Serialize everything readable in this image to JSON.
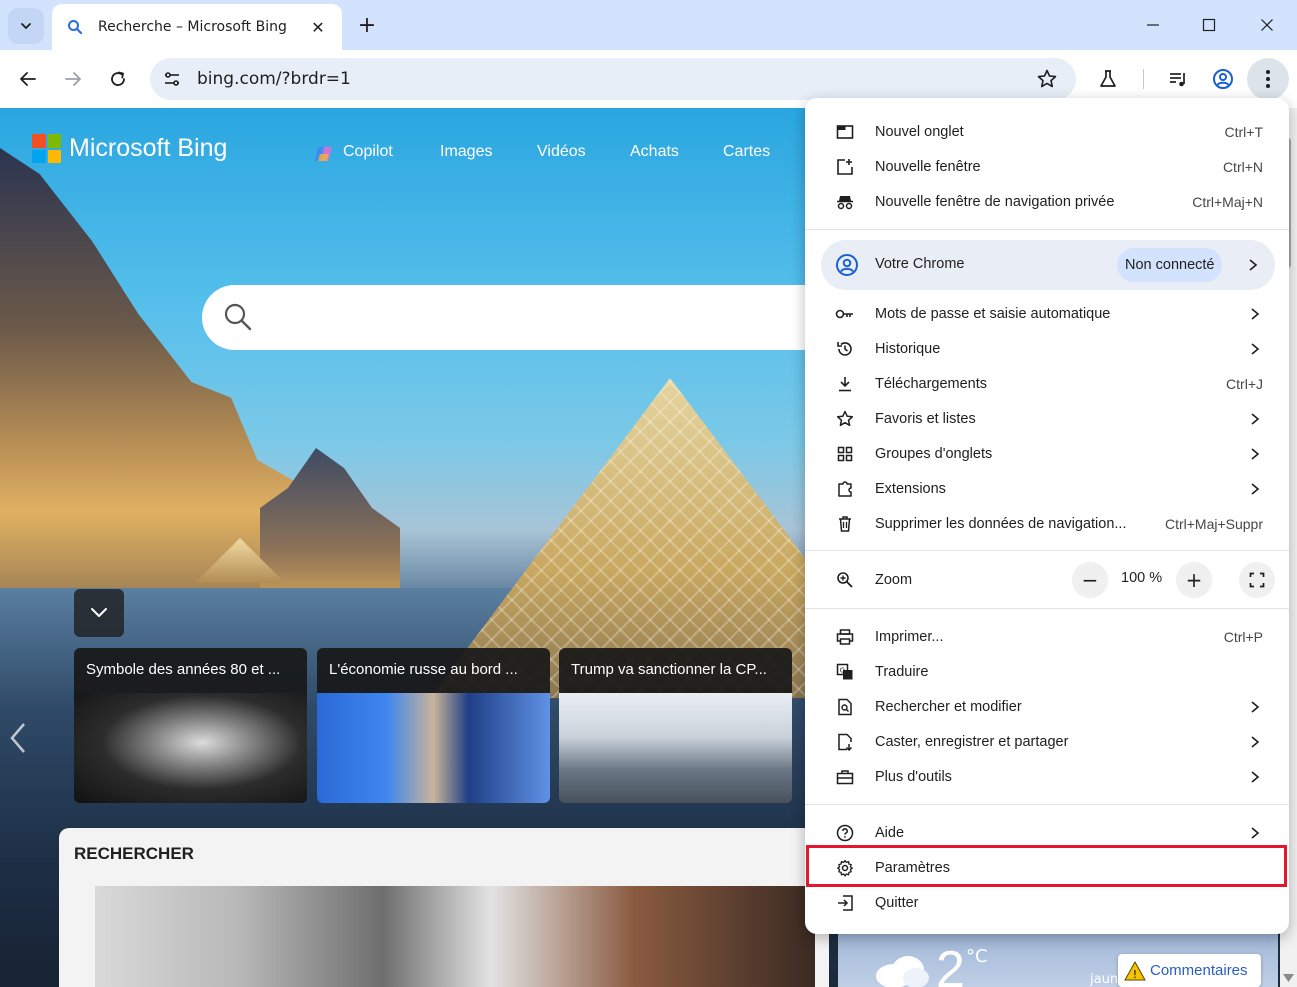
{
  "tab": {
    "title": "Recherche – Microsoft Bing",
    "close_glyph": "✕",
    "new_tab_glyph": "+"
  },
  "toolbar": {
    "url": "bing.com/?brdr=1"
  },
  "bing": {
    "logo_text": "Microsoft Bing",
    "nav": [
      "Copilot",
      "Images",
      "Vidéos",
      "Achats",
      "Cartes"
    ],
    "news": [
      "Symbole des années 80 et ...",
      "L'économie russe au bord ...",
      "Trump va sanctionner la CP..."
    ],
    "recherche_label": "RECHERCHER",
    "weather_temp": "2",
    "weather_unit": "°C",
    "weather_condition": "jaune Neige",
    "feedback_label": "Commentaires"
  },
  "menu": {
    "new_tab": {
      "label": "Nouvel onglet",
      "shortcut": "Ctrl+T"
    },
    "new_window": {
      "label": "Nouvelle fenêtre",
      "shortcut": "Ctrl+N"
    },
    "incognito": {
      "label": "Nouvelle fenêtre de navigation privée",
      "shortcut": "Ctrl+Maj+N"
    },
    "profile": {
      "label": "Votre Chrome",
      "status": "Non connecté"
    },
    "passwords": {
      "label": "Mots de passe et saisie automatique"
    },
    "history": {
      "label": "Historique"
    },
    "downloads": {
      "label": "Téléchargements",
      "shortcut": "Ctrl+J"
    },
    "bookmarks": {
      "label": "Favoris et listes"
    },
    "tab_groups": {
      "label": "Groupes d'onglets"
    },
    "extensions": {
      "label": "Extensions"
    },
    "clear_data": {
      "label": "Supprimer les données de navigation...",
      "shortcut": "Ctrl+Maj+Suppr"
    },
    "zoom": {
      "label": "Zoom",
      "value": "100 %",
      "minus": "−",
      "plus": "+"
    },
    "print": {
      "label": "Imprimer...",
      "shortcut": "Ctrl+P"
    },
    "translate": {
      "label": "Traduire"
    },
    "find_edit": {
      "label": "Rechercher et modifier"
    },
    "cast_save_share": {
      "label": "Caster, enregistrer et partager"
    },
    "more_tools": {
      "label": "Plus d'outils"
    },
    "help": {
      "label": "Aide"
    },
    "settings": {
      "label": "Paramètres"
    },
    "exit": {
      "label": "Quitter"
    }
  },
  "colors": {
    "tabstrip": "#d3e3fd",
    "highlight": "#e4172e",
    "ms_red": "#f25022",
    "ms_green": "#7fba00",
    "ms_blue": "#00a4ef",
    "ms_yellow": "#ffb900"
  }
}
